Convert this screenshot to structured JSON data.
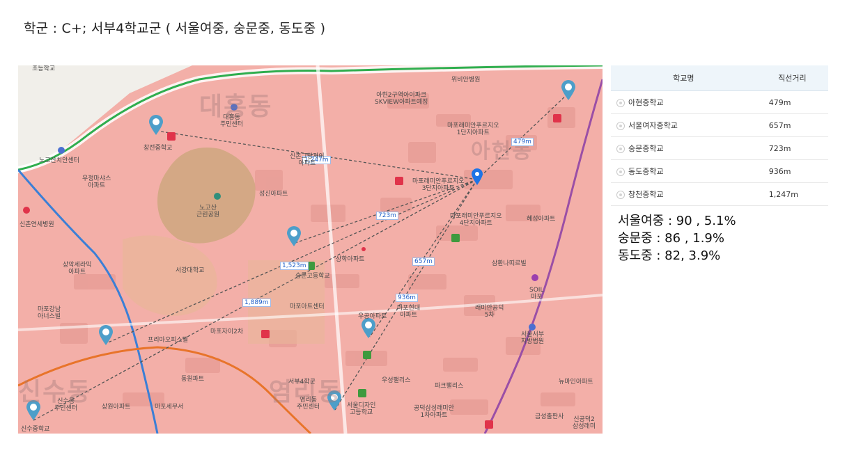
{
  "header": {
    "title": "학군 : C+; 서부4학교군 ( 서울여중, 숭문중, 동도중 )"
  },
  "table": {
    "columns": [
      "학교명",
      "직선거리"
    ],
    "rows": [
      {
        "name": "아현중학교",
        "distance": "479m"
      },
      {
        "name": "서울여자중학교",
        "distance": "657m"
      },
      {
        "name": "숭문중학교",
        "distance": "723m"
      },
      {
        "name": "동도중학교",
        "distance": "936m"
      },
      {
        "name": "창천중학교",
        "distance": "1,247m"
      }
    ]
  },
  "stats": [
    {
      "text": "서울여중 : 90  , 5.1%"
    },
    {
      "text": "숭문중 : 86 , 1.9%"
    },
    {
      "text": "동도중 : 82,  3.9%"
    }
  ],
  "map": {
    "district_labels": {
      "daeheung": "대흥동",
      "ahyeon": "아현동",
      "sinsu": "신수동",
      "yeomni": "염리동"
    },
    "distance_labels": {
      "d479": "479m",
      "d1247": "1,247m",
      "d723": "723m",
      "d657": "657m",
      "d1523": "1,523m",
      "d1889": "1,889m",
      "d936": "936m"
    },
    "places": {
      "chogyo": "초등학교",
      "wibiyang": "위비안병원",
      "ahyeon2": "아현2구역아이파크\nSKVIEW아파트예정",
      "mapo_raemian1": "마포래미안푸르지오\n1단지아파트",
      "changjeon_ms": "창전중학교",
      "daeheung_center": "대흥동\n주민센터",
      "nogosan_clinic": "노고산치안센터",
      "woojeong": "우정마샤스\n아파트",
      "sinchon_grand": "신촌그랑자이\n아파트",
      "mapo_raemian3": "마포래미안푸르지오\n3단지아파트",
      "nogosan_park": "노고산\n근린공원",
      "seongsan": "성신아파트",
      "sinchon_severance": "신촌연세병원",
      "mapo_raemian4": "마포래미안푸르지오\n4단지아파트",
      "hyeseong": "혜성아파트",
      "sangak": "상악세라믹\n아파트",
      "sogang": "서강대학교",
      "sungmun_hs": "숭문고등학교",
      "sangap": "상학아파트",
      "samhwan": "삼환나띠르빌",
      "soil": "SOIL\n마포",
      "mapo_artcenter": "마포아트센터",
      "mapo_hyundai": "마포현대\n아파트",
      "raemian_gongdeok": "래미안공덕\n5차",
      "mapo_gangnam": "마포강남\n아너스빌",
      "uganda": "우공아파트",
      "seoul_seobu": "서울서부\n지방법원",
      "prima": "프리마오피스텔",
      "mapo_xi": "마포자이2차",
      "dongwon": "동원파트",
      "seobu_education": "서부4학군",
      "yeomni_center": "염리동\n주민센터",
      "woosung": "우성팰리스",
      "park_palace": "파크팰리스",
      "new_main": "뉴마인아파트",
      "sinsu_center": "신수동\n주민센터",
      "sangwon": "상원아파트",
      "mapo_tax": "마포세무서",
      "seoul_design_hs": "서울디자인\n고등학교",
      "gongdeok_samsung": "공덕삼성래미안\n1차아파트",
      "geumseong": "금성출판사",
      "sinsu_ms": "신수중학교",
      "sinkong": "신공덕2\n삼성래미",
      "ahyeon_label": "아현동"
    },
    "colors": {
      "zone": "#f2a8a2",
      "road_green": "#2fae4e",
      "road_blue": "#3b7fd6",
      "road_orange": "#e8742a",
      "road_purple": "#9a4fa6",
      "pin_school": "#4d9ec9",
      "pin_target": "#1e74e6",
      "dashed": "#555555"
    }
  }
}
